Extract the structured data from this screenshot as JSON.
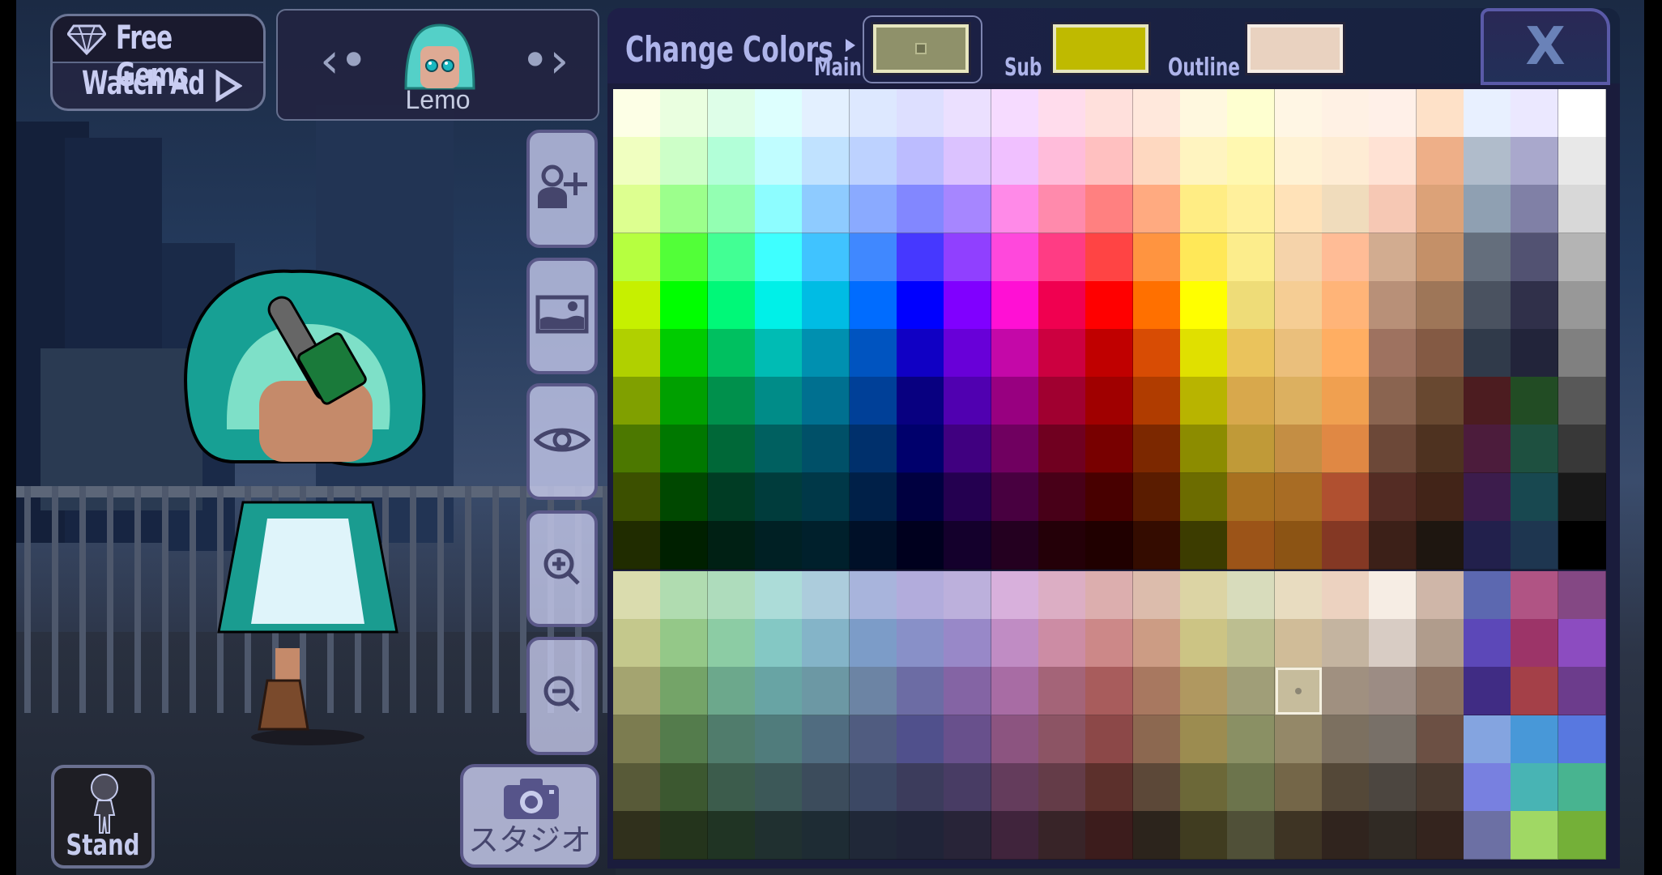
{
  "top_left": {
    "free_gems_label": "Free Gems",
    "watch_ad_label": "Watch Ad",
    "gem_icon": "gem-icon",
    "play_icon": "play-triangle-icon"
  },
  "character_selector": {
    "name": "Lemo",
    "prev_icon": "chevron-left-icon",
    "next_icon": "chevron-right-icon"
  },
  "toolbar": [
    {
      "name": "add-character-button",
      "icon": "person-add-icon"
    },
    {
      "name": "background-button",
      "icon": "image-icon"
    },
    {
      "name": "hide-ui-button",
      "icon": "eye-icon"
    },
    {
      "name": "zoom-in-button",
      "icon": "zoom-in-icon"
    },
    {
      "name": "zoom-out-button",
      "icon": "zoom-out-icon"
    }
  ],
  "studio_button": {
    "label": "スタジオ",
    "icon": "camera-icon"
  },
  "stand_button": {
    "label": "Stand",
    "icon": "figure-icon"
  },
  "change_colors": {
    "title": "Change Colors",
    "main_label": "Main",
    "sub_label": "Sub",
    "outline_label": "Outline",
    "main_color": "#8f916a",
    "sub_color": "#bfba00",
    "outline_color": "#e9d2c0",
    "active_slot": "Main",
    "close_label": "X",
    "selected_cell": {
      "section": "bottom",
      "row": 2,
      "col": 14
    }
  },
  "palette_top": [
    [
      "#fdffe6",
      "#eaffe0",
      "#defee8",
      "#ddfffe",
      "#e3f0ff",
      "#dde8ff",
      "#dddfff",
      "#ebe0ff",
      "#f6dbff",
      "#ffdcec",
      "#ffe0dc",
      "#ffe8dc",
      "#fff8df",
      "#feffd0",
      "#fff6e4",
      "#fff1e4",
      "#fff0e8",
      "#fee1c8",
      "#e8f0ff",
      "#ebe8ff",
      "#ffffff"
    ],
    [
      "#f0ffc0",
      "#cdffc8",
      "#b2ffd8",
      "#c0fdff",
      "#c0e2ff",
      "#bdd2ff",
      "#bcbcff",
      "#dbc2ff",
      "#f0c0ff",
      "#ffbcda",
      "#ffc0c0",
      "#fed8c0",
      "#fff4c0",
      "#fff8b0",
      "#fff2d4",
      "#feecd4",
      "#ffe2d4",
      "#eeaf88",
      "#b0bccb",
      "#a9a8cc",
      "#e8e8e8"
    ],
    [
      "#ddff90",
      "#9cff8c",
      "#93ffb2",
      "#8dfdff",
      "#8ecbff",
      "#8aaaff",
      "#8287ff",
      "#a686ff",
      "#ff8ae8",
      "#ff8aac",
      "#ff8080",
      "#ffaa80",
      "#ffed84",
      "#fff09c",
      "#ffe2b8",
      "#f0dcbc",
      "#f6c8b4",
      "#dca278",
      "#8fa0b2",
      "#8080a6",
      "#d8d8d8"
    ],
    [
      "#b6ff40",
      "#52ff38",
      "#42ff94",
      "#3effff",
      "#40c3ff",
      "#4088ff",
      "#4638ff",
      "#9040ff",
      "#ff48dc",
      "#ff3c84",
      "#ff4444",
      "#ff9440",
      "#ffe858",
      "#fced8c",
      "#f5d3aa",
      "#ffbc96",
      "#d2ac90",
      "#c49068",
      "#646e7c",
      "#525272",
      "#b4b4b4"
    ],
    [
      "#c6f000",
      "#00ff00",
      "#00f878",
      "#00f0e8",
      "#00bce4",
      "#006cff",
      "#0000ff",
      "#8000ff",
      "#ff10d4",
      "#f00050",
      "#ff0000",
      "#ff7000",
      "#ffff00",
      "#eedc78",
      "#f5cd94",
      "#ffb478",
      "#b89078",
      "#9e7658",
      "#4a5260",
      "#30304a",
      "#989898"
    ],
    [
      "#b0d000",
      "#00cc00",
      "#00c060",
      "#00bcb4",
      "#0090b0",
      "#0054c0",
      "#1000c4",
      "#6800d8",
      "#c408a8",
      "#cc0040",
      "#c00000",
      "#d84c04",
      "#e0e000",
      "#eac35c",
      "#eabf7c",
      "#ffae62",
      "#9e7260",
      "#845a44",
      "#303a4a",
      "#22243a",
      "#808080"
    ],
    [
      "#80a000",
      "#00a000",
      "#00904c",
      "#008c88",
      "#007090",
      "#004098",
      "#080080",
      "#5000b0",
      "#980080",
      "#a00030",
      "#a00000",
      "#b03c00",
      "#b8b400",
      "#d8a84c",
      "#dcb060",
      "#f0a050",
      "#8a6450",
      "#684830",
      "#4c1c20",
      "#224c24",
      "#585858"
    ],
    [
      "#4c7800",
      "#007800",
      "#006838",
      "#006060",
      "#005068",
      "#00306c",
      "#00006c",
      "#400080",
      "#700060",
      "#700020",
      "#780000",
      "#7c2800",
      "#8c8c00",
      "#c09a38",
      "#c48e44",
      "#e08844",
      "#6c4838",
      "#4e3220",
      "#4c1c3c",
      "#1e5040",
      "#383838"
    ],
    [
      "#3c5000",
      "#004800",
      "#003c24",
      "#003c3c",
      "#003848",
      "#002048",
      "#000040",
      "#240050",
      "#480040",
      "#480018",
      "#480000",
      "#5a1c00",
      "#6c6c00",
      "#a87020",
      "#a86c24",
      "#b05030",
      "#542c24",
      "#422418",
      "#3c1c4c",
      "#184850",
      "#181818"
    ],
    [
      "#202c00",
      "#002000",
      "#002014",
      "#002024",
      "#00202c",
      "#001028",
      "#00001e",
      "#14002c",
      "#240020",
      "#240008",
      "#200000",
      "#340c00",
      "#3c3c00",
      "#9c5418",
      "#8c5414",
      "#843824",
      "#3c2018",
      "#1e1610",
      "#22204c",
      "#1e3650",
      "#000000"
    ]
  ],
  "palette_bottom": [
    [
      "#dadcae",
      "#b0dcb0",
      "#aedcbc",
      "#acdcd8",
      "#acccdc",
      "#a8b4dc",
      "#b2acdc",
      "#bcb0dc",
      "#d8b0dc",
      "#dcaec4",
      "#dcaeae",
      "#dcbcac",
      "#dcd4a4",
      "#d8dcbc",
      "#e8dcc0",
      "#ecd2c0",
      "#f6ede4",
      "#cfb6a8",
      "#5c68b0",
      "#b05484",
      "#844884"
    ],
    [
      "#c4c88c",
      "#94c888",
      "#8ccca4",
      "#84c8c4",
      "#84b4c8",
      "#7c9cc8",
      "#8890c8",
      "#9888c8",
      "#c08cc4",
      "#cc8ca4",
      "#cc8888",
      "#cc9c84",
      "#ccc484",
      "#bcbe90",
      "#d0bc98",
      "#c4b4a0",
      "#d8ccc4",
      "#b09c8c",
      "#5c48b8",
      "#9c3468",
      "#8c4cc0"
    ],
    [
      "#a4a470",
      "#74a468",
      "#6ca88c",
      "#68a4a4",
      "#6c98a4",
      "#6c84a4",
      "#6c6ca4",
      "#8464a4",
      "#a86ca4",
      "#a46478",
      "#a85c5c",
      "#a87860",
      "#b09860",
      "#a09e78",
      "#c6bc9c",
      "#a09080",
      "#9c8c84",
      "#8a7060",
      "#402c84",
      "#a44048",
      "#6c3c8c"
    ],
    [
      "#7c7c50",
      "#547c4c",
      "#507c6c",
      "#507c7c",
      "#506c80",
      "#505c80",
      "#50508c",
      "#68508c",
      "#8c5480",
      "#8c5464",
      "#8c4848",
      "#8c6850",
      "#9c8c50",
      "#8a9064",
      "#948868",
      "#7c7060",
      "#787068",
      "#6c5044",
      "#84a4e0",
      "#4898d8",
      "#5878e0"
    ],
    [
      "#585a38",
      "#3c5830",
      "#3c5c4c",
      "#3c5858",
      "#3c4c5c",
      "#3c4864",
      "#3c3c5c",
      "#483c64",
      "#643c5c",
      "#643c48",
      "#5c302c",
      "#5c4838",
      "#6c6838",
      "#6c744c",
      "#746648",
      "#544838",
      "#4c4640",
      "#4a3a30",
      "#7880e0",
      "#48b4b4",
      "#48b490"
    ],
    [
      "#30301c",
      "#24341c",
      "#203424",
      "#203030",
      "#1e2c34",
      "#202838",
      "#202438",
      "#282438",
      "#40243c",
      "#382428",
      "#3c1c1c",
      "#2c241c",
      "#403c20",
      "#505038",
      "#3e3424",
      "#30241e",
      "#302a24",
      "#34241e",
      "#6c70a4",
      "#a0d864",
      "#74b038"
    ]
  ]
}
